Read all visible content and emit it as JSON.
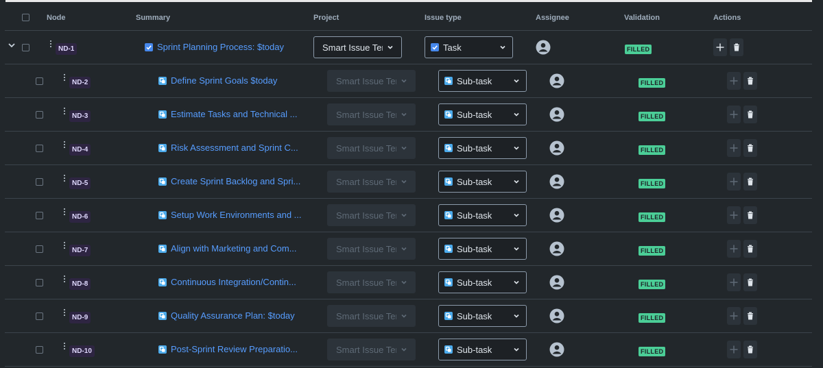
{
  "headers": {
    "node": "Node",
    "summary": "Summary",
    "project": "Project",
    "issue_type": "Issue type",
    "assignee": "Assignee",
    "validation": "Validation",
    "actions": "Actions"
  },
  "colors": {
    "background": "#22272b",
    "link": "#579dff",
    "filled_badge": "#4bce97",
    "node_badge_bg": "#2e2542",
    "task_icon": "#4688ec",
    "subtask_icon": "#4cabec"
  },
  "rows": [
    {
      "node": "ND-1",
      "summary": "Sprint Planning Process: $today",
      "project": "Smart Issue Ten",
      "issue_type": "Task",
      "issue_icon": "task-checkbox-icon",
      "validation": "FILLED",
      "level": 0
    },
    {
      "node": "ND-2",
      "summary": "Define Sprint Goals $today",
      "project": "Smart Issue Ten",
      "issue_type": "Sub-task",
      "issue_icon": "subtask-icon",
      "validation": "FILLED",
      "level": 1
    },
    {
      "node": "ND-3",
      "summary": "Estimate Tasks and Technical ...",
      "project": "Smart Issue Ten",
      "issue_type": "Sub-task",
      "issue_icon": "subtask-icon",
      "validation": "FILLED",
      "level": 1
    },
    {
      "node": "ND-4",
      "summary": "Risk Assessment and Sprint C...",
      "project": "Smart Issue Ten",
      "issue_type": "Sub-task",
      "issue_icon": "subtask-icon",
      "validation": "FILLED",
      "level": 1
    },
    {
      "node": "ND-5",
      "summary": "Create Sprint Backlog and Spri...",
      "project": "Smart Issue Ten",
      "issue_type": "Sub-task",
      "issue_icon": "subtask-icon",
      "validation": "FILLED",
      "level": 1
    },
    {
      "node": "ND-6",
      "summary": "Setup Work Environments and ...",
      "project": "Smart Issue Ten",
      "issue_type": "Sub-task",
      "issue_icon": "subtask-icon",
      "validation": "FILLED",
      "level": 1
    },
    {
      "node": "ND-7",
      "summary": "Align with Marketing and Com...",
      "project": "Smart Issue Ten",
      "issue_type": "Sub-task",
      "issue_icon": "subtask-icon",
      "validation": "FILLED",
      "level": 1
    },
    {
      "node": "ND-8",
      "summary": "Continuous Integration/Contin...",
      "project": "Smart Issue Ten",
      "issue_type": "Sub-task",
      "issue_icon": "subtask-icon",
      "validation": "FILLED",
      "level": 1
    },
    {
      "node": "ND-9",
      "summary": "Quality Assurance Plan: $today",
      "project": "Smart Issue Ten",
      "issue_type": "Sub-task",
      "issue_icon": "subtask-icon",
      "validation": "FILLED",
      "level": 1
    },
    {
      "node": "ND-10",
      "summary": "Post-Sprint Review Preparatio...",
      "project": "Smart Issue Ten",
      "issue_type": "Sub-task",
      "issue_icon": "subtask-icon",
      "validation": "FILLED",
      "level": 1
    }
  ]
}
